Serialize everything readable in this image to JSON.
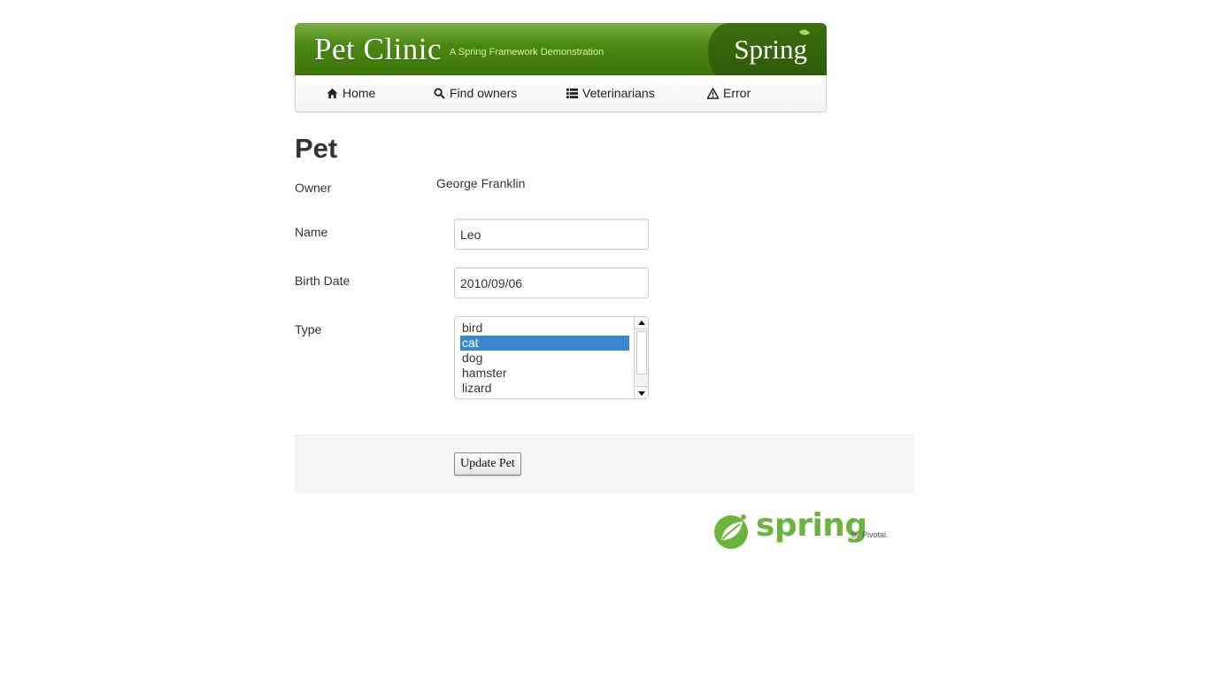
{
  "header": {
    "title": "Pet Clinic",
    "tagline": "A Spring Framework Demonstration",
    "brand": "Spring"
  },
  "nav": {
    "items": [
      {
        "label": "Home",
        "icon": "home-icon"
      },
      {
        "label": "Find owners",
        "icon": "search-icon"
      },
      {
        "label": "Veterinarians",
        "icon": "list-icon"
      },
      {
        "label": "Error",
        "icon": "warning-icon"
      }
    ]
  },
  "page": {
    "heading": "Pet"
  },
  "form": {
    "owner_label": "Owner",
    "owner_value": "George Franklin",
    "name_label": "Name",
    "name_value": "Leo",
    "birth_label": "Birth Date",
    "birth_value": "2010/09/06",
    "type_label": "Type",
    "type_options": [
      "bird",
      "cat",
      "dog",
      "hamster",
      "lizard"
    ],
    "type_selected": "cat",
    "submit_label": "Update Pet"
  },
  "footer": {
    "logo_text": "spring",
    "logo_by": "by Pivotal."
  },
  "colors": {
    "brand_green": "#4a8712",
    "spring_green": "#6db33f",
    "selection_blue": "#3a87d1"
  }
}
